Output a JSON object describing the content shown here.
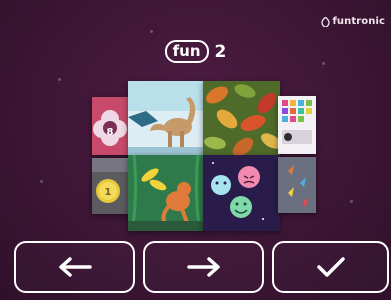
{
  "brand": {
    "name": "funtronic",
    "icon": "funtronic-logo-icon"
  },
  "header": {
    "pill_label": "fun",
    "level": "2"
  },
  "tiles": [
    {
      "name": "tile-number-flower",
      "icon": "flower-number-icon",
      "badge": "8"
    },
    {
      "name": "tile-dinosaur",
      "icon": "dinosaur-icon"
    },
    {
      "name": "tile-autumn-leaves",
      "icon": "leaves-icon"
    },
    {
      "name": "tile-color-blocks",
      "icon": "color-grid-icon"
    },
    {
      "name": "tile-number-coin",
      "icon": "coin-number-icon",
      "badge": "1"
    },
    {
      "name": "tile-jungle-monkey",
      "icon": "monkey-icon"
    },
    {
      "name": "tile-emotion-faces",
      "icon": "emoji-faces-icon"
    },
    {
      "name": "tile-rockets",
      "icon": "rocket-icon"
    }
  ],
  "controls": {
    "prev": {
      "icon": "arrow-left-icon"
    },
    "next": {
      "icon": "arrow-right-icon"
    },
    "confirm": {
      "icon": "checkmark-icon"
    }
  },
  "colors": {
    "background": "#3d1636",
    "foreground": "#ffffff"
  }
}
